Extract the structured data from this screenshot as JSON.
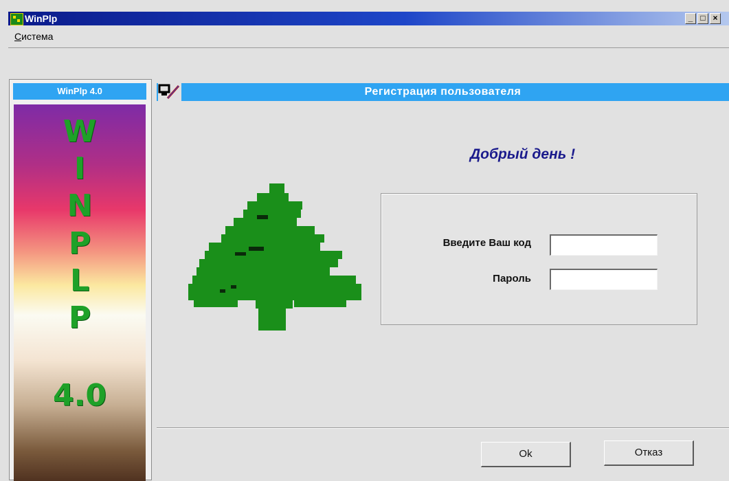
{
  "window": {
    "title": "WinPlp",
    "minimize_glyph": "_",
    "maximize_glyph": "□",
    "close_glyph": "×"
  },
  "menu": {
    "items": [
      {
        "accel": "С",
        "rest": "истема"
      }
    ]
  },
  "sidebar": {
    "header": "WinPlp 4.0",
    "letters": [
      "W",
      "I",
      "N",
      "P",
      "L",
      "P"
    ],
    "version": "4.0"
  },
  "dialog": {
    "header_title": "Регистрация пользователя",
    "header_icon": "pen-icon",
    "greeting": "Добрый день !",
    "image": "christmas-tree-icon",
    "fields": {
      "code_label": "Введите Ваш код",
      "code_value": "",
      "password_label": "Пароль",
      "password_value": ""
    },
    "buttons": {
      "ok": "Ok",
      "cancel": "Отказ"
    }
  },
  "colors": {
    "header_bar": "#2fa4f2",
    "tree_green": "#1a8f1a",
    "letter_green": "#1ea128",
    "greeting": "#1a1a8c"
  }
}
